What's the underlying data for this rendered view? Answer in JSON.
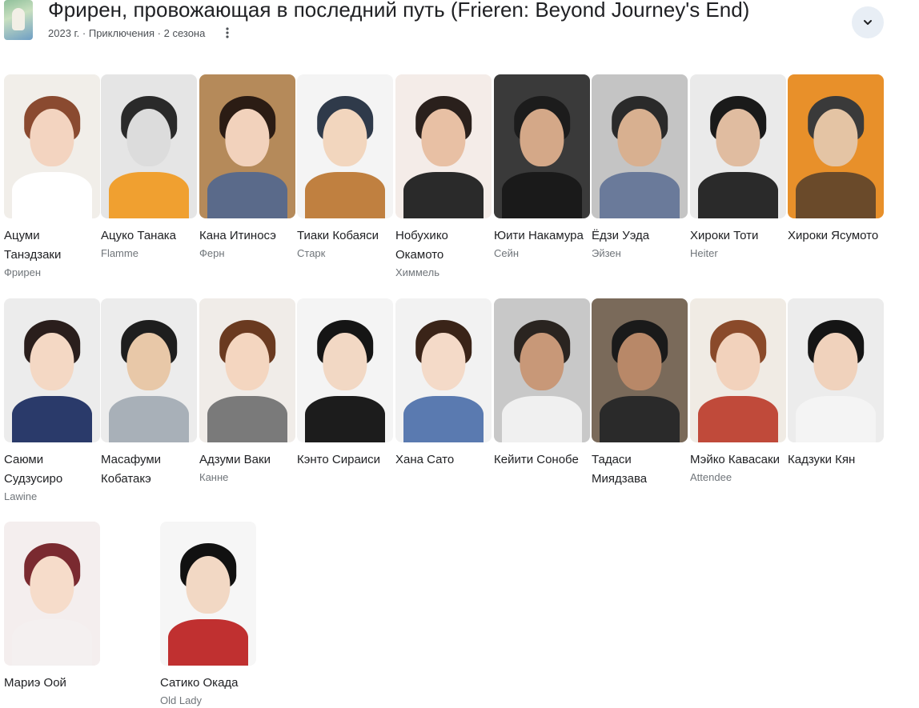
{
  "header": {
    "title": "Фрирен, провожающая в последний путь (Frieren: Beyond Journey's End)",
    "subtitle": "2023 г. · Приключения · 2 сезона",
    "more_icon": "more-vert-icon",
    "expand_icon": "chevron-down-icon"
  },
  "cast": [
    {
      "name": "Ацуми Танэдзаки",
      "role": "Фрирен",
      "colors": {
        "bg": "#f1eee9",
        "hair": "#8a4a30",
        "skin": "#f3d4c0",
        "body": "#ffffff"
      }
    },
    {
      "name": "Ацуко Танака",
      "role": "Flamme",
      "colors": {
        "bg": "#e5e5e5",
        "hair": "#2a2a2a",
        "skin": "#dcdcdc",
        "body": "#f0a030"
      }
    },
    {
      "name": "Кана Итиносэ",
      "role": "Ферн",
      "colors": {
        "bg": "#b58a5a",
        "hair": "#2b1c14",
        "skin": "#f2d2bc",
        "body": "#5a6a8a"
      }
    },
    {
      "name": "Тиаки Кобаяси",
      "role": "Старк",
      "colors": {
        "bg": "#f4f4f4",
        "hair": "#2f3a4a",
        "skin": "#f2d6be",
        "body": "#c08040"
      }
    },
    {
      "name": "Нобухико Окамото",
      "role": "Химмель",
      "colors": {
        "bg": "#f4ece8",
        "hair": "#2a201c",
        "skin": "#e8c0a4",
        "body": "#2a2a2a"
      }
    },
    {
      "name": "Юити Накамура",
      "role": "Сейн",
      "colors": {
        "bg": "#3a3a3a",
        "hair": "#1c1c1c",
        "skin": "#d4a888",
        "body": "#1a1a1a"
      }
    },
    {
      "name": "Ёдзи Уэда",
      "role": "Эйзен",
      "colors": {
        "bg": "#c4c4c4",
        "hair": "#2a2a2a",
        "skin": "#d8b090",
        "body": "#6a7a9a"
      }
    },
    {
      "name": "Хироки Тоти",
      "role": "Heiter",
      "colors": {
        "bg": "#eaeaea",
        "hair": "#1a1a1a",
        "skin": "#e0bca0",
        "body": "#2a2a2a"
      }
    },
    {
      "name": "Хироки Ясумото",
      "role": "",
      "colors": {
        "bg": "#e8902a",
        "hair": "#3a3a3a",
        "skin": "#e4c4a4",
        "body": "#6a4a2a"
      }
    },
    {
      "name": "Саюми Судзусиро",
      "role": "Lawine",
      "colors": {
        "bg": "#ececec",
        "hair": "#2a1e1c",
        "skin": "#f4d8c4",
        "body": "#2a3a6a"
      }
    },
    {
      "name": "Масафуми Кобатакэ",
      "role": "",
      "colors": {
        "bg": "#ececec",
        "hair": "#1e1e1e",
        "skin": "#e8c8a8",
        "body": "#a8b0b8"
      }
    },
    {
      "name": "Адзуми Ваки",
      "role": "Канне",
      "colors": {
        "bg": "#f0ece8",
        "hair": "#6a3a20",
        "skin": "#f4d6c0",
        "body": "#7a7a7a"
      }
    },
    {
      "name": "Кэнто Сираиси",
      "role": "",
      "colors": {
        "bg": "#f4f4f4",
        "hair": "#151515",
        "skin": "#f2d8c4",
        "body": "#1c1c1c"
      }
    },
    {
      "name": "Хана Сато",
      "role": "",
      "colors": {
        "bg": "#f2f2f2",
        "hair": "#3a2418",
        "skin": "#f4dac8",
        "body": "#5a7ab0"
      }
    },
    {
      "name": "Кейити Сонобе",
      "role": "",
      "colors": {
        "bg": "#c8c8c8",
        "hair": "#2a2420",
        "skin": "#c89878",
        "body": "#f0f0f0"
      }
    },
    {
      "name": "Тадаси Миядзава",
      "role": "",
      "colors": {
        "bg": "#7a6a5a",
        "hair": "#1a1a1a",
        "skin": "#b88868",
        "body": "#2a2a2a"
      }
    },
    {
      "name": "Мэйко Кавасаки",
      "role": "Attendee",
      "colors": {
        "bg": "#f0ebe4",
        "hair": "#8a4a2a",
        "skin": "#f2d2bc",
        "body": "#c04a3a"
      }
    },
    {
      "name": "Кадзуки Кян",
      "role": "",
      "colors": {
        "bg": "#ececec",
        "hair": "#151515",
        "skin": "#f0d2bc",
        "body": "#f4f4f4"
      }
    },
    {
      "name": "Мариэ Оой",
      "role": "",
      "colors": {
        "bg": "#f4eeee",
        "hair": "#7a2a30",
        "skin": "#f6dcca",
        "body": "#f4f0f0"
      }
    },
    {
      "name": "Сатико Окада",
      "role": "Old Lady",
      "colors": {
        "bg": "#f6f6f6",
        "hair": "#111111",
        "skin": "#f2d8c4",
        "body": "#c03030"
      }
    }
  ]
}
